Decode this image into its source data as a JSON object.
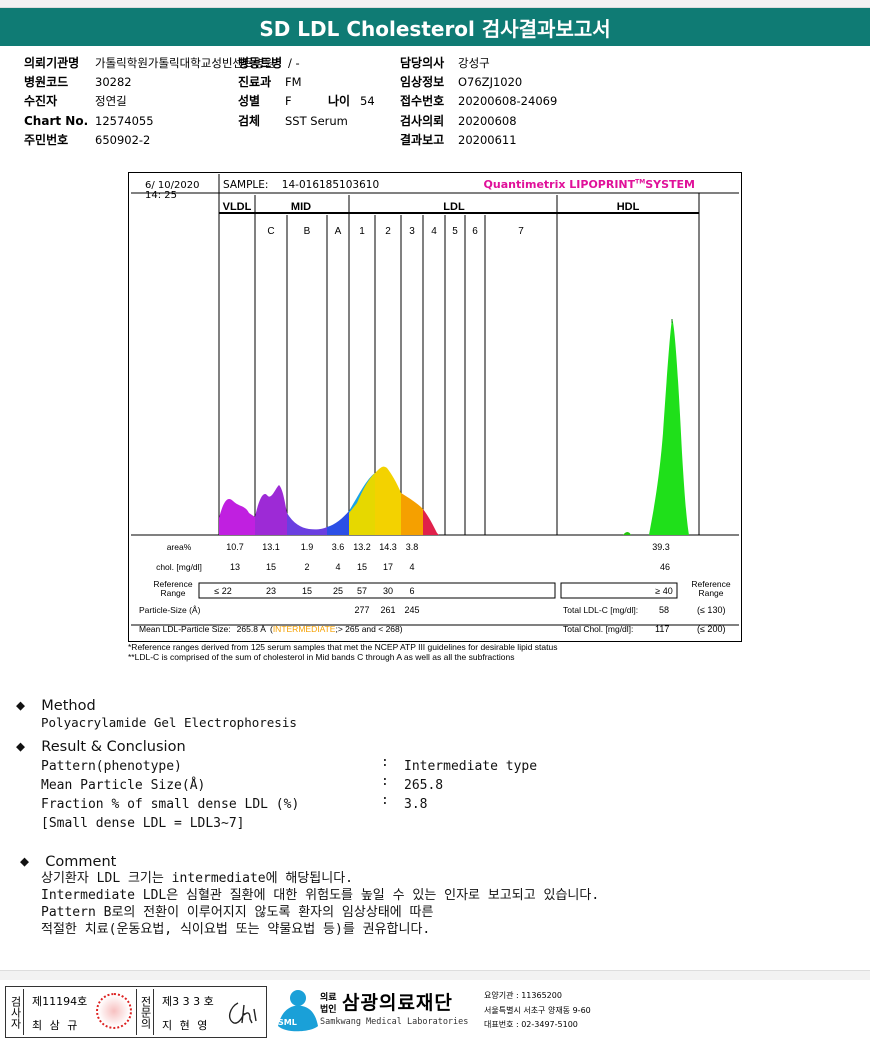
{
  "header": {
    "title": "SD LDL Cholesterol 검사결과보고서"
  },
  "patient": {
    "institution_label": "의뢰기관명",
    "institution": "가톨릭학원가톨릭대학교성빈센트병원",
    "ward_label": "병동트병",
    "ward": "/ -",
    "doctor_label": "담당의사",
    "doctor": "강성구",
    "code_label": "병원코드",
    "code": "30282",
    "dept_label": "진료과",
    "dept": "FM",
    "clinical_label": "임상정보",
    "clinical": "O76ZJ1020",
    "recipient_label": "수진자",
    "recipient": "정연길",
    "sex_label": "성별",
    "sex": "F",
    "age_label": "나이",
    "age": "54",
    "receipt_label": "접수번호",
    "receipt": "20200608-24069",
    "chart_label": "Chart No.",
    "chart": "12574055",
    "specimen_label": "검체",
    "specimen": "SST Serum",
    "request_label": "검사의뢰",
    "request": "20200608",
    "id_label": "주민번호",
    "id": "650902-2",
    "report_label": "결과보고",
    "report_date": "20200611"
  },
  "printout": {
    "date": "6/ 10/2020",
    "time": "14: 25",
    "sample": "SAMPLE:    14-016185103610",
    "brand": "Quantimetrix LIPOPRINT",
    "brand_tm": "TM",
    "brand_tail": "SYSTEM",
    "groups": [
      "VLDL",
      "MID",
      "LDL",
      "HDL"
    ],
    "bands": [
      "C",
      "B",
      "A",
      "1",
      "2",
      "3",
      "4",
      "5",
      "6",
      "7"
    ],
    "area_label": "area%",
    "area_values": [
      "10.7",
      "13.1",
      "1.9",
      "3.6",
      "13.2",
      "14.3",
      "3.8",
      "39.3"
    ],
    "chol_label": "chol. [mg/dl]",
    "chol_values": [
      "13",
      "15",
      "2",
      "4",
      "15",
      "17",
      "4",
      "46"
    ],
    "ref_label_1": "Reference",
    "ref_label_2": "Range",
    "ref_values": [
      "≤ 22",
      "23",
      "15",
      "25",
      "57",
      "30",
      "6",
      "≥ 40"
    ],
    "ref_right_1": "Reference",
    "ref_right_2": "Range",
    "particle_label": "Particle-Size (Å)",
    "particle_values": [
      "277",
      "261",
      "245"
    ],
    "total_ldl_label": "Total LDL-C [mg/dl]:",
    "total_ldl_value": "58",
    "total_ldl_range": "(≤ 130)",
    "mean_label": "Mean LDL-Particle Size:",
    "mean_value": "265.8 Å",
    "mean_open": "(",
    "mean_class": "INTERMEDIATE",
    "mean_tail": ";> 265 and < 268)",
    "total_chol_label": "Total Chol. [mg/dl]:",
    "total_chol_value": "117",
    "total_chol_range": "(≤ 200)",
    "note1": "*Reference ranges derived from 125 serum samples that met the NCEP ATP III guidelines for desirable lipid status",
    "note2": "**LDL-C is comprised of the sum of cholesterol in Mid bands C through A as well as all the subfractions"
  },
  "method": {
    "title": "Method",
    "text": "Polyacrylamide Gel Electrophoresis"
  },
  "result": {
    "title": "Result & Conclusion",
    "rows": [
      {
        "label": "Pattern(phenotype)",
        "colon": ":",
        "value": "Intermediate type"
      },
      {
        "label": "Mean Particle Size(Å)",
        "colon": ":",
        "value": "265.8"
      },
      {
        "label": "Fraction % of small dense LDL (%)",
        "colon": ":",
        "value": "3.8"
      }
    ],
    "note": "[Small dense LDL = LDL3~7]"
  },
  "comment": {
    "title": "Comment",
    "lines": [
      "상기환자 LDL 크기는 intermediate에 해당됩니다.",
      "Intermediate LDL은 심혈관 질환에 대한 위험도를 높일 수 있는 인자로 보고되고 있습니다.",
      "Pattern B로의 전환이 이루어지지 않도록 환자의 임상상태에 따른",
      "적절한 치료(운동요법, 식이요법 또는 약물요법 등)를 권유합니다."
    ]
  },
  "footer": {
    "examiner_label": "검사자",
    "examiner_no": "제11194호",
    "examiner_name": "최 삼 규",
    "specialist_label": "전문의",
    "specialist_no": "제3 3 3 호",
    "specialist_name": "지 현 영",
    "org_prefix_1": "의료",
    "org_prefix_2": "법인",
    "org_name": "삼광의료재단",
    "org_en": "Samkwang Medical Laboratories",
    "org_code": "요양기관 : 11365200",
    "org_addr": "서울특별시 서초구 양재동 9-60",
    "org_phone": "대표번호 : 02-3497-5100",
    "logo_text": "SML"
  }
}
